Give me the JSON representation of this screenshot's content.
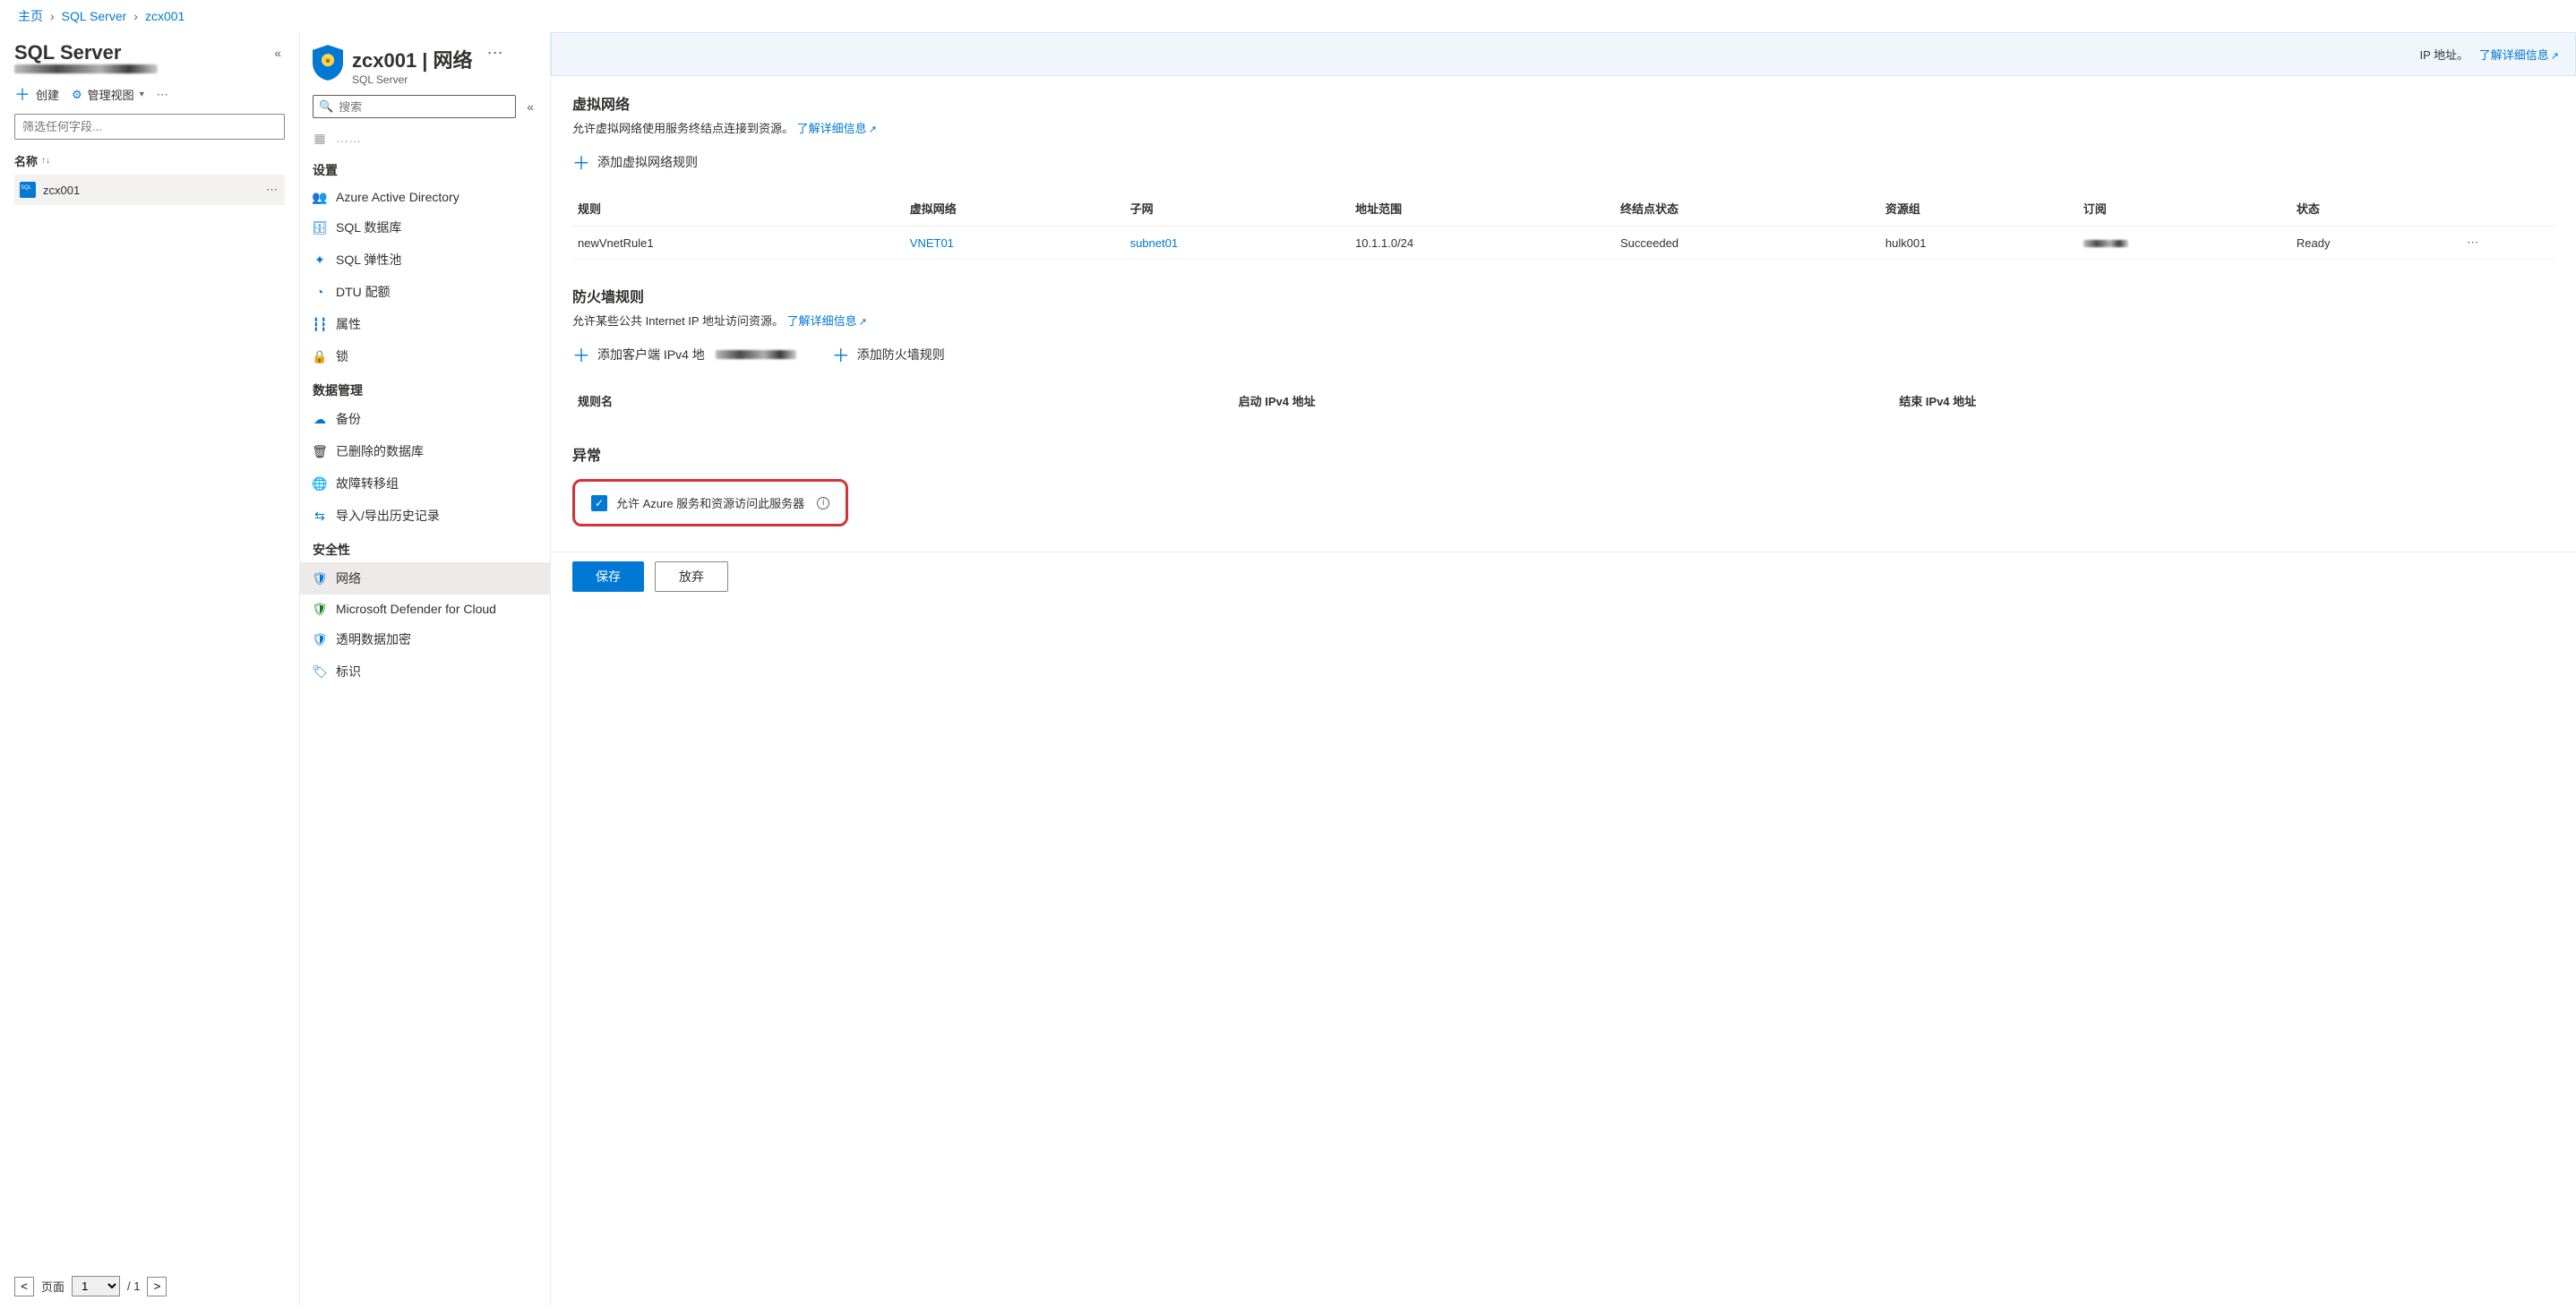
{
  "breadcrumb": {
    "home": "主页",
    "level1": "SQL Server",
    "level2": "zcx001"
  },
  "list_panel": {
    "title": "SQL Server",
    "create": "创建",
    "manage_view": "管理视图",
    "filter_placeholder": "筛选任何字段...",
    "col_name": "名称",
    "item": "zcx001",
    "page_label": "页面",
    "page_total": "/ 1"
  },
  "nav": {
    "title": "zcx001 | 网络",
    "subtitle": "SQL Server",
    "search_placeholder": "搜索",
    "truncated": "……",
    "group_settings": "设置",
    "aad": "Azure Active Directory",
    "sql_db": "SQL 数据库",
    "elastic": "SQL 弹性池",
    "dtu": "DTU 配额",
    "props": "属性",
    "lock": "锁",
    "group_data": "数据管理",
    "backup": "备份",
    "deleted_db": "已删除的数据库",
    "failover": "故障转移组",
    "import_export": "导入/导出历史记录",
    "group_security": "安全性",
    "network": "网络",
    "defender": "Microsoft Defender for Cloud",
    "tde": "透明数据加密",
    "tags": "标识"
  },
  "main": {
    "strip_prefix": "IP 地址。",
    "strip_link": "了解详细信息",
    "vnet": {
      "title": "虚拟网络",
      "desc": "允许虚拟网络使用服务终结点连接到资源。",
      "desc_link": "了解详细信息",
      "add": "添加虚拟网络规则",
      "cols": {
        "rule": "规则",
        "vnet": "虚拟网络",
        "subnet": "子网",
        "range": "地址范围",
        "endpoint": "终结点状态",
        "rg": "资源组",
        "sub": "订阅",
        "state": "状态"
      },
      "row": {
        "rule": "newVnetRule1",
        "vnet": "VNET01",
        "subnet": "subnet01",
        "range": "10.1.1.0/24",
        "endpoint": "Succeeded",
        "rg": "hulk001",
        "state": "Ready"
      }
    },
    "fw": {
      "title": "防火墙规则",
      "desc": "允许某些公共 Internet IP 地址访问资源。",
      "desc_link": "了解详细信息",
      "add_client": "添加客户端 IPv4 地",
      "add_rule": "添加防火墙规则",
      "cols": {
        "name": "规则名",
        "start": "启动 IPv4 地址",
        "end": "结束 IPv4 地址"
      }
    },
    "exc": {
      "title": "异常",
      "checkbox": "允许 Azure 服务和资源访问此服务器"
    },
    "save": "保存",
    "discard": "放弃"
  }
}
